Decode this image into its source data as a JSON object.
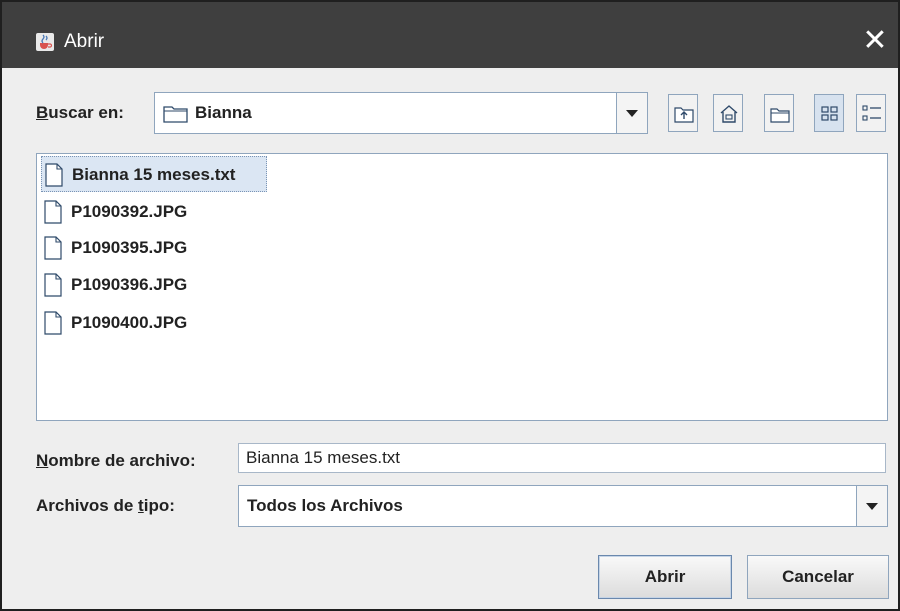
{
  "window": {
    "title": "Abrir",
    "app_icon": "java-cup-icon",
    "close_icon": "close-icon",
    "close_glyph": "✕"
  },
  "lookin": {
    "label_mnemonic": "B",
    "label_rest": "uscar en:",
    "value": "Bianna",
    "value_icon": "folder-icon"
  },
  "toolbar": {
    "buttons": [
      {
        "name": "up-folder-icon"
      },
      {
        "name": "home-icon"
      },
      {
        "name": "new-folder-icon"
      },
      {
        "name": "list-view-icon",
        "selected": true
      },
      {
        "name": "details-view-icon"
      }
    ]
  },
  "files": [
    {
      "name": "Bianna 15 meses.txt",
      "selected": true
    },
    {
      "name": "P1090392.JPG"
    },
    {
      "name": "P1090395.JPG"
    },
    {
      "name": "P1090396.JPG"
    },
    {
      "name": "P1090400.JPG"
    }
  ],
  "filename": {
    "label_mnemonic": "N",
    "label_rest": "ombre de archivo:",
    "value": "Bianna 15 meses.txt"
  },
  "filetype": {
    "label_pre": "Archivos de ",
    "label_mnemonic": "t",
    "label_rest": "ipo:",
    "value": "Todos los Archivos"
  },
  "buttons": {
    "open": "Abrir",
    "cancel": "Cancelar"
  },
  "colors": {
    "titlebar": "#3f3f3f",
    "dialog_bg": "#eeeeee",
    "selection": "#dbe6f3",
    "border": "#8fa5bd"
  }
}
